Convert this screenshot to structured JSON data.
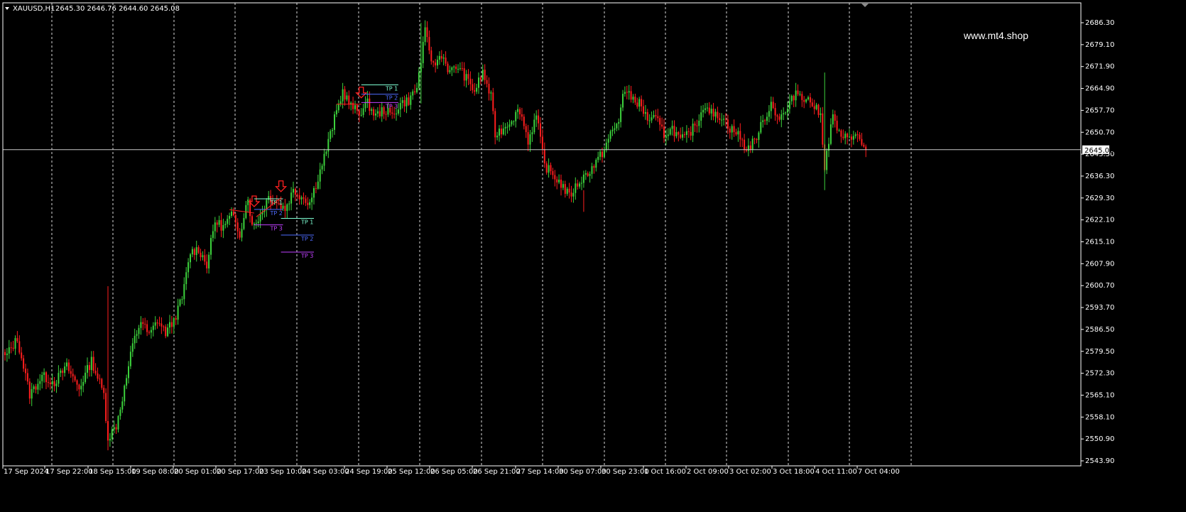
{
  "header": {
    "symbol": "XAUUSD,H1",
    "ohlc": "2645.30 2646.76 2644.60 2645.08"
  },
  "watermark": "www.mt4.shop",
  "current_price_label": "2645.08",
  "colors": {
    "background": "#000000",
    "bull": "#3CD23C",
    "bear": "#FF1E1E",
    "grid": "#FFFFFF",
    "axis": "#FFFFFF",
    "signal_arrow": "#FF2020",
    "tp1": "#7FFFD4",
    "tp2": "#4E6BFF",
    "tp3": "#C040FF"
  },
  "chart_data": {
    "type": "candlestick",
    "symbol": "XAUUSD",
    "timeframe": "H1",
    "ylim": [
      2543.9,
      2690.0
    ],
    "grid": true,
    "y_ticks": [
      "2686.30",
      "2679.10",
      "2671.90",
      "2664.90",
      "2657.70",
      "2650.70",
      "2643.50",
      "2636.30",
      "2629.30",
      "2622.10",
      "2615.10",
      "2607.90",
      "2600.70",
      "2593.70",
      "2586.50",
      "2579.50",
      "2572.30",
      "2565.10",
      "2558.10",
      "2550.90",
      "2543.90"
    ],
    "x_ticks": [
      "17 Sep 2024",
      "17 Sep 22:00",
      "18 Sep 15:00",
      "19 Sep 08:00",
      "20 Sep 01:00",
      "20 Sep 17:00",
      "23 Sep 10:00",
      "24 Sep 03:00",
      "24 Sep 19:00",
      "25 Sep 12:00",
      "26 Sep 05:00",
      "26 Sep 21:00",
      "27 Sep 14:00",
      "30 Sep 07:00",
      "30 Sep 23:00",
      "1 Oct 16:00",
      "2 Oct 09:00",
      "3 Oct 02:00",
      "3 Oct 18:00",
      "4 Oct 11:00",
      "7 Oct 04:00"
    ],
    "current_price": 2645.08,
    "anchors": [
      [
        0,
        2578
      ],
      [
        6,
        2584
      ],
      [
        12,
        2566
      ],
      [
        18,
        2572
      ],
      [
        24,
        2570
      ],
      [
        30,
        2575
      ],
      [
        36,
        2568
      ],
      [
        42,
        2577
      ],
      [
        48,
        2566
      ],
      [
        50,
        2552
      ],
      [
        54,
        2556
      ],
      [
        58,
        2568
      ],
      [
        62,
        2582
      ],
      [
        66,
        2590
      ],
      [
        70,
        2585
      ],
      [
        74,
        2590
      ],
      [
        78,
        2586
      ],
      [
        82,
        2590
      ],
      [
        86,
        2597
      ],
      [
        90,
        2612
      ],
      [
        94,
        2613
      ],
      [
        98,
        2608
      ],
      [
        102,
        2622
      ],
      [
        106,
        2620
      ],
      [
        110,
        2624
      ],
      [
        114,
        2618
      ],
      [
        118,
        2630
      ],
      [
        120,
        2620
      ],
      [
        124,
        2624
      ],
      [
        128,
        2630
      ],
      [
        132,
        2628
      ],
      [
        136,
        2626
      ],
      [
        140,
        2632
      ],
      [
        144,
        2630
      ],
      [
        148,
        2628
      ],
      [
        152,
        2636
      ],
      [
        156,
        2645
      ],
      [
        160,
        2655
      ],
      [
        164,
        2664
      ],
      [
        168,
        2659
      ],
      [
        172,
        2657
      ],
      [
        176,
        2660
      ],
      [
        180,
        2656
      ],
      [
        184,
        2658
      ],
      [
        188,
        2656
      ],
      [
        192,
        2660
      ],
      [
        196,
        2661
      ],
      [
        200,
        2665
      ],
      [
        204,
        2683
      ],
      [
        208,
        2672
      ],
      [
        212,
        2676
      ],
      [
        216,
        2670
      ],
      [
        220,
        2672
      ],
      [
        224,
        2668
      ],
      [
        228,
        2664
      ],
      [
        232,
        2670
      ],
      [
        236,
        2662
      ],
      [
        238,
        2650
      ],
      [
        242,
        2652
      ],
      [
        246,
        2655
      ],
      [
        250,
        2658
      ],
      [
        254,
        2648
      ],
      [
        258,
        2656
      ],
      [
        262,
        2640
      ],
      [
        266,
        2637
      ],
      [
        270,
        2634
      ],
      [
        274,
        2630
      ],
      [
        278,
        2634
      ],
      [
        282,
        2637
      ],
      [
        286,
        2640
      ],
      [
        290,
        2644
      ],
      [
        294,
        2650
      ],
      [
        298,
        2654
      ],
      [
        300,
        2664
      ],
      [
        304,
        2662
      ],
      [
        308,
        2660
      ],
      [
        312,
        2655
      ],
      [
        316,
        2655
      ],
      [
        320,
        2650
      ],
      [
        324,
        2652
      ],
      [
        328,
        2648
      ],
      [
        332,
        2650
      ],
      [
        336,
        2654
      ],
      [
        340,
        2660
      ],
      [
        344,
        2656
      ],
      [
        348,
        2656
      ],
      [
        352,
        2652
      ],
      [
        356,
        2650
      ],
      [
        360,
        2645
      ],
      [
        364,
        2648
      ],
      [
        368,
        2654
      ],
      [
        372,
        2660
      ],
      [
        376,
        2655
      ],
      [
        380,
        2658
      ],
      [
        384,
        2664
      ],
      [
        388,
        2662
      ],
      [
        392,
        2660
      ],
      [
        396,
        2656
      ],
      [
        398,
        2640
      ],
      [
        402,
        2656
      ],
      [
        406,
        2648
      ],
      [
        410,
        2650
      ],
      [
        414,
        2649
      ],
      [
        418,
        2645
      ]
    ],
    "signals": [
      {
        "type": "sell",
        "bar": 121,
        "tp_labels": [
          "TP 1",
          "TP 2",
          "TP 3"
        ],
        "tp_prices": [
          2629.2,
          2625.8,
          2620.8
        ],
        "width": 14
      },
      {
        "type": "sell",
        "bar": 134,
        "tp_labels": [
          "TP 1",
          "TP 2",
          "TP 3"
        ],
        "tp_prices": [
          2622.9,
          2617.5,
          2612.0
        ],
        "width": 16
      },
      {
        "type": "sell",
        "bar": 173,
        "tp_labels": [
          "TP 1",
          "TP 2",
          "TP 3"
        ],
        "tp_prices": [
          2666.0,
          2663.0,
          2660.3
        ],
        "width": 18
      }
    ]
  }
}
